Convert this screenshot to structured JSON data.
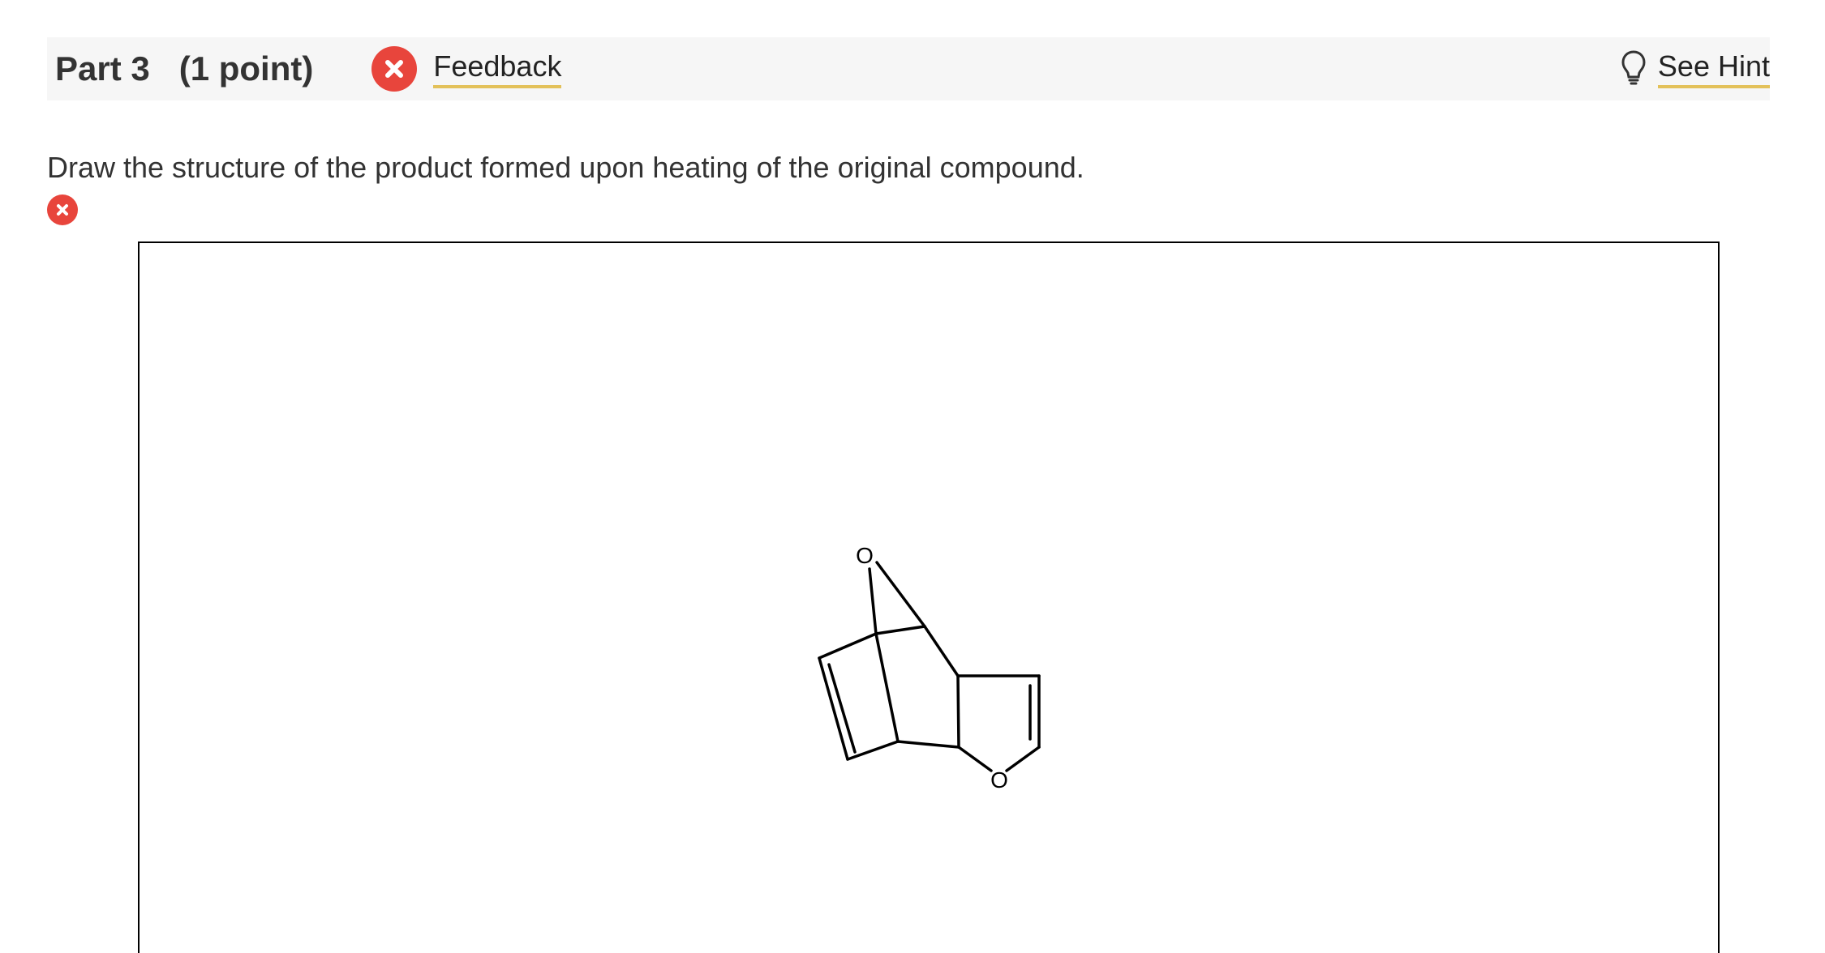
{
  "part": {
    "label": "Part 3",
    "points": "(1 point)"
  },
  "feedback": {
    "label": "Feedback",
    "status": "incorrect",
    "status_color": "#e8453c"
  },
  "hint": {
    "label": "See Hint",
    "icon": "lightbulb-icon"
  },
  "question": {
    "text": "Draw the structure of the product formed upon heating of the original compound.",
    "status": "incorrect"
  },
  "molecule": {
    "atom_labels": [
      "O",
      "O"
    ]
  },
  "colors": {
    "error": "#e8453c",
    "link_underline": "#e3c15a",
    "header_bg": "#f6f6f6"
  }
}
